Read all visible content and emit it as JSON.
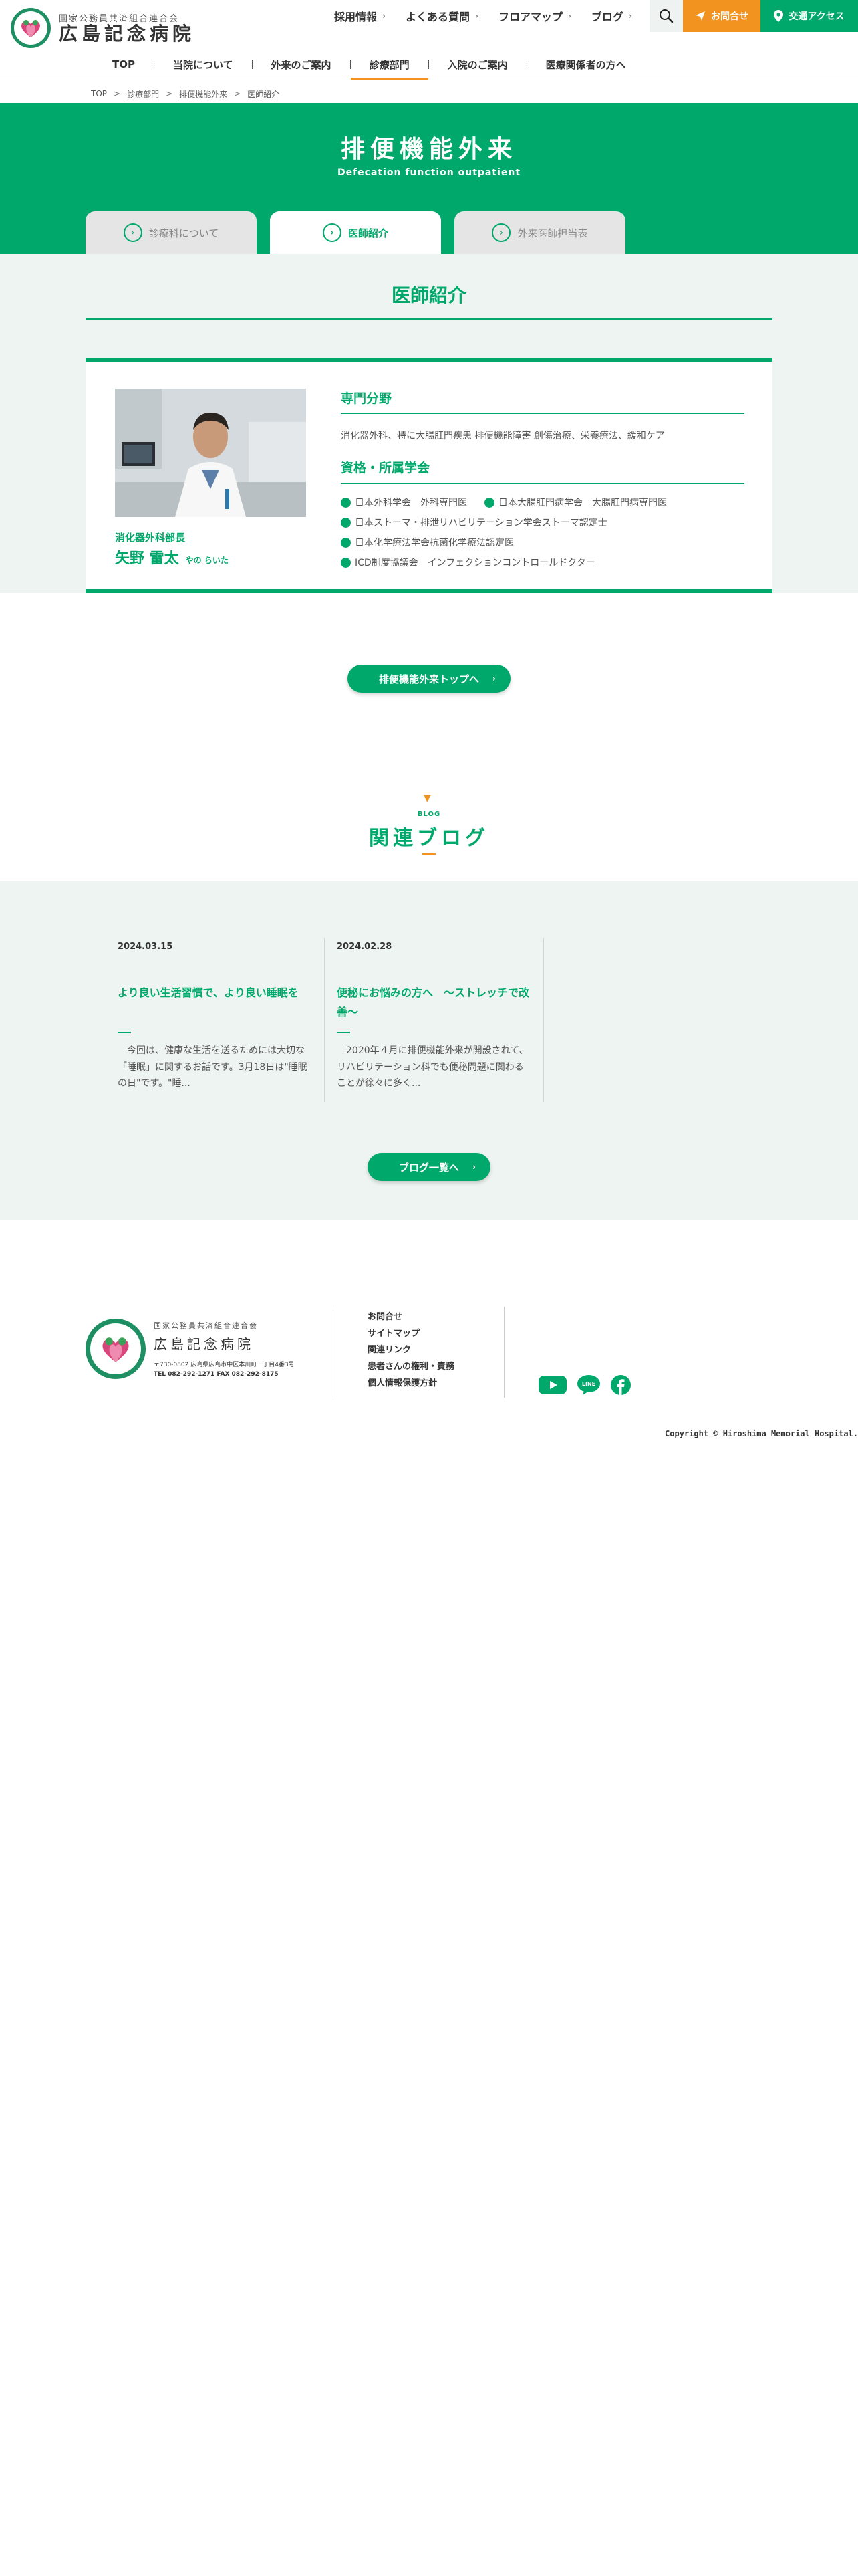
{
  "header": {
    "logo_sub": "国家公務員共済組合連合会",
    "logo_main": "広島記念病院",
    "top_links": [
      "採用情報",
      "よくある質問",
      "フロアマップ",
      "ブログ"
    ],
    "contact_label": "お問合せ",
    "access_label": "交通アクセス"
  },
  "nav": {
    "items": [
      "TOP",
      "当院について",
      "外来のご案内",
      "診療部門",
      "入院のご案内",
      "医療関係者の方へ"
    ]
  },
  "breadcrumb": [
    "TOP",
    "診療部門",
    "排便機能外来",
    "医師紹介"
  ],
  "hero": {
    "title": "排便機能外来",
    "subtitle": "Defecation function outpatient",
    "tabs": [
      "診療科について",
      "医師紹介",
      "外来医師担当表"
    ]
  },
  "doctors": {
    "section_title": "医師紹介",
    "dept": "消化器外科部長",
    "name": "矢野 雷太",
    "kana": "やの らいた",
    "specialty_label": "専門分野",
    "specialty_text": "消化器外科、特に大腸肛門疾患 排便機能障害 創傷治療、栄養療法、緩和ケア",
    "qual_label": "資格・所属学会",
    "qualifications": [
      "日本外科学会　外科専門医",
      "日本大腸肛門病学会　大腸肛門病専門医",
      "日本ストーマ・排泄リハビリテーション学会ストーマ認定士",
      "日本化学療法学会抗菌化学療法認定医",
      "ICD制度協議会　インフェクションコントロールドクター"
    ]
  },
  "outpatient_top_label": "排便機能外来トップへ",
  "blog": {
    "title_en": "BLOG",
    "title": "関連ブログ",
    "posts": [
      {
        "date": "2024.03.15",
        "title": "より良い生活習慣で、より良い睡眠を",
        "excerpt": "　今回は、健康な生活を送るためには大切な「睡眠」に関するお話です。3月18日は\"睡眠の日\"です。\"睡..."
      },
      {
        "date": "2024.02.28",
        "title": "便秘にお悩みの方へ　～ストレッチで改善～",
        "excerpt": "　2020年４月に排便機能外来が開設されて、リハビリテーション科でも便秘問題に関わることが徐々に多く..."
      }
    ],
    "list_button": "ブログ一覧へ"
  },
  "footer": {
    "logo_sub": "国家公務員共済組合連合会",
    "logo_main": "広島記念病院",
    "address": "〒730-0802 広島県広島市中区本川町一丁目4番3号",
    "tel": "TEL 082-292-1271 FAX 082-292-8175",
    "links": [
      "お問合せ",
      "サイトマップ",
      "関連リンク",
      "患者さんの権利・責務",
      "個人情報保護方針"
    ],
    "line_label": "LINE",
    "copyright": "Copyright © Hiroshima Memorial Hospital."
  },
  "colors": {
    "brand_green": "#00a96b",
    "accent_orange": "#f29320",
    "section_bg": "#eef4f2"
  },
  "icons": [
    "search-icon",
    "paper-plane-icon",
    "map-pin-icon",
    "chevron-right-icon",
    "youtube-icon",
    "line-icon",
    "facebook-icon"
  ]
}
